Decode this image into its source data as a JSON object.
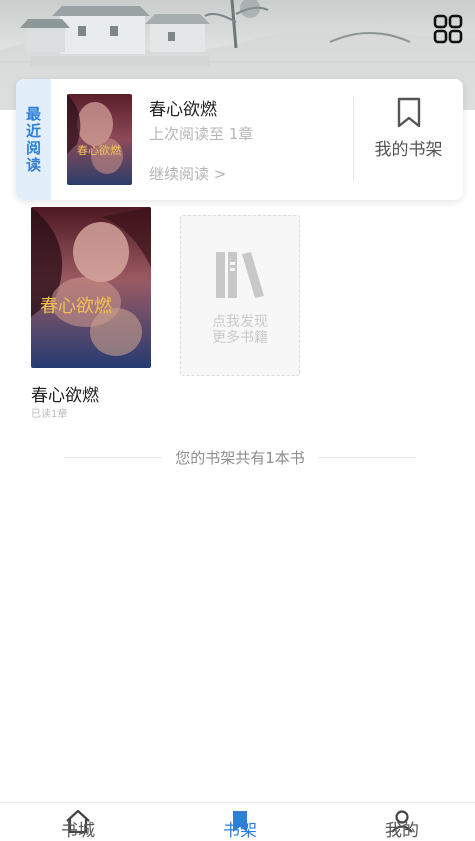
{
  "header": {
    "grid_icon": "grid-icon"
  },
  "recent": {
    "tag": "最近阅读",
    "title": "春心欲燃",
    "progress": "上次阅读至 1章",
    "continue": "继续阅读 >",
    "shelf_label": "我的书架",
    "cover_text": "春心欲燃"
  },
  "shelf": {
    "books": [
      {
        "title": "春心欲燃",
        "progress": "已读1章",
        "cover_text": "春心欲燃"
      }
    ],
    "discover_line1": "点我发现",
    "discover_line2": "更多书籍",
    "count_text": "您的书架共有1本书"
  },
  "nav": {
    "items": [
      {
        "label": "书城",
        "icon": "home-icon"
      },
      {
        "label": "书架",
        "icon": "bookshelf-icon",
        "active": true
      },
      {
        "label": "我的",
        "icon": "profile-icon"
      }
    ]
  },
  "colors": {
    "accent": "#2f7fd6",
    "tag_bg": "#e3eefb"
  }
}
